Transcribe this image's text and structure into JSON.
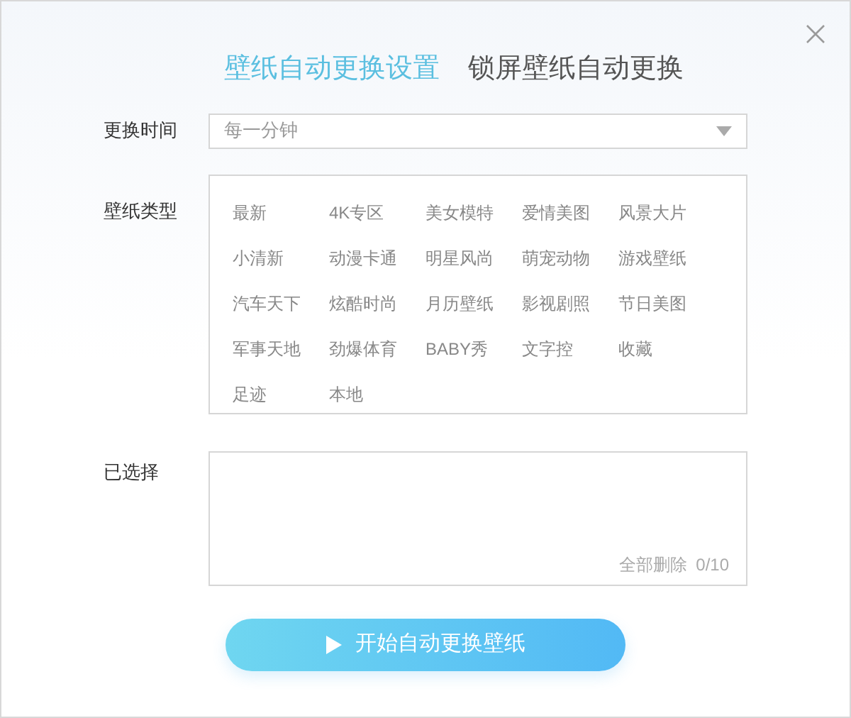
{
  "tabs": [
    {
      "label": "壁纸自动更换设置",
      "selected": true
    },
    {
      "label": "锁屏壁纸自动更换",
      "selected": false
    }
  ],
  "interval": {
    "label": "更换时间",
    "value": "每一分钟"
  },
  "types": {
    "label": "壁纸类型",
    "items": [
      "最新",
      "4K专区",
      "美女模特",
      "爱情美图",
      "风景大片",
      "小清新",
      "动漫卡通",
      "明星风尚",
      "萌宠动物",
      "游戏壁纸",
      "汽车天下",
      "炫酷时尚",
      "月历壁纸",
      "影视剧照",
      "节日美图",
      "军事天地",
      "劲爆体育",
      "BABY秀",
      "文字控",
      "收藏",
      "足迹",
      "本地"
    ]
  },
  "selected_panel": {
    "label": "已选择",
    "clear_all": "全部删除",
    "count": "0/10"
  },
  "start_button": {
    "label": "开始自动更换壁纸"
  }
}
